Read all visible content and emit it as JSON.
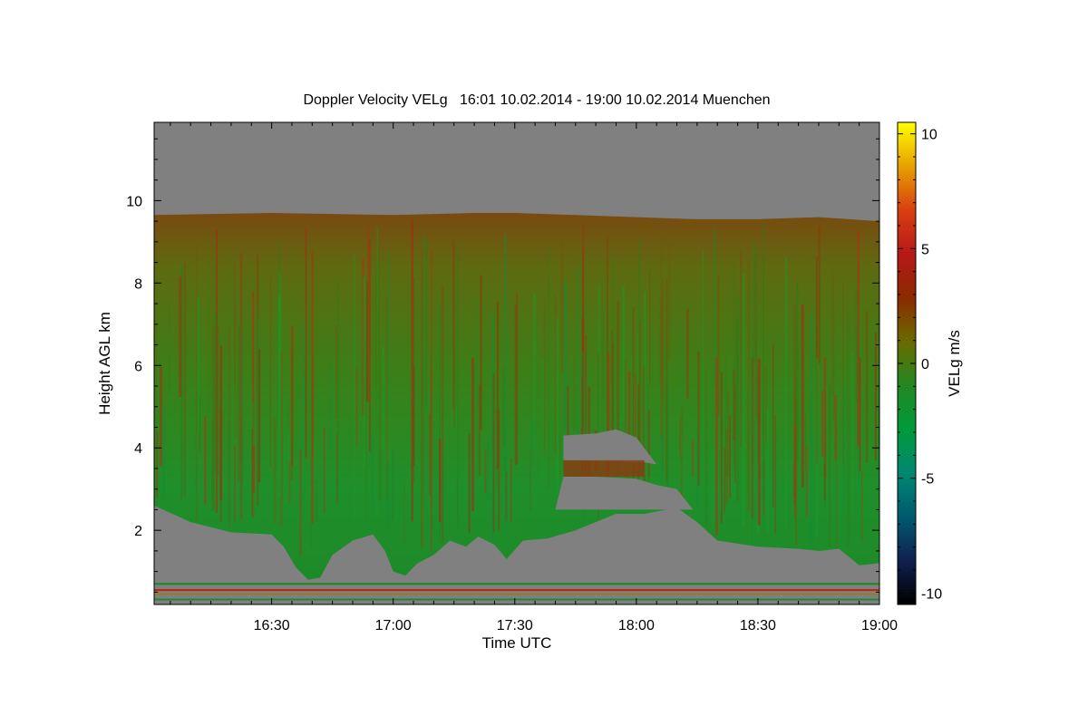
{
  "chart_data": {
    "type": "heatmap",
    "title": "Doppler Velocity VELg   16:01 10.02.2014 - 19:00 10.02.2014 Muenchen",
    "xlabel": "Time UTC",
    "ylabel": "Height AGL km",
    "x_range": [
      "16:01",
      "19:00"
    ],
    "x_ticks": [
      "16:30",
      "17:00",
      "17:30",
      "18:00",
      "18:30",
      "19:00"
    ],
    "ylim": [
      0.2,
      11.9
    ],
    "y_ticks": [
      2,
      4,
      6,
      8,
      10
    ],
    "colorbar": {
      "label": "VELg m/s",
      "range": [
        -10.5,
        10.5
      ],
      "ticks": [
        10,
        5,
        0,
        -5,
        -10
      ],
      "colors": [
        "#ffff00",
        "#e8a000",
        "#d84010",
        "#b81818",
        "#8a2a00",
        "#6a6a00",
        "#228822",
        "#009a3a",
        "#008870",
        "#005a70",
        "#102050",
        "#000000"
      ]
    },
    "no_data_color": "#808080",
    "echo_top_km": [
      [
        "16:01",
        9.65
      ],
      [
        "16:30",
        9.7
      ],
      [
        "17:00",
        9.65
      ],
      [
        "17:20",
        9.7
      ],
      [
        "17:30",
        9.7
      ],
      [
        "17:45",
        9.65
      ],
      [
        "18:00",
        9.6
      ],
      [
        "18:15",
        9.55
      ],
      [
        "18:30",
        9.55
      ],
      [
        "18:45",
        9.6
      ],
      [
        "19:00",
        9.5
      ]
    ],
    "cloud_base_km": [
      [
        "16:01",
        2.6
      ],
      [
        "16:10",
        2.2
      ],
      [
        "16:20",
        1.95
      ],
      [
        "16:30",
        1.9
      ],
      [
        "16:33",
        1.6
      ],
      [
        "16:36",
        1.1
      ],
      [
        "16:39",
        0.8
      ],
      [
        "16:42",
        0.85
      ],
      [
        "16:45",
        1.4
      ],
      [
        "16:50",
        1.75
      ],
      [
        "16:55",
        1.9
      ],
      [
        "16:58",
        1.5
      ],
      [
        "17:00",
        1.0
      ],
      [
        "17:03",
        0.9
      ],
      [
        "17:06",
        1.2
      ],
      [
        "17:10",
        1.4
      ],
      [
        "17:14",
        1.75
      ],
      [
        "17:18",
        1.6
      ],
      [
        "17:21",
        1.85
      ],
      [
        "17:25",
        1.65
      ],
      [
        "17:28",
        1.3
      ],
      [
        "17:32",
        1.75
      ],
      [
        "17:38",
        1.8
      ],
      [
        "17:45",
        2.0
      ],
      [
        "17:55",
        2.4
      ],
      [
        "18:02",
        2.4
      ],
      [
        "18:10",
        2.55
      ],
      [
        "18:15",
        2.2
      ],
      [
        "18:20",
        1.75
      ],
      [
        "18:30",
        1.6
      ],
      [
        "18:40",
        1.55
      ],
      [
        "18:45",
        1.5
      ],
      [
        "18:50",
        1.55
      ],
      [
        "18:55",
        1.15
      ],
      [
        "19:00",
        1.2
      ]
    ],
    "clear_gaps": [
      {
        "top_km": [
          [
            "17:42",
            4.3
          ],
          [
            "17:50",
            4.35
          ],
          [
            "17:55",
            4.45
          ],
          [
            "18:00",
            4.25
          ],
          [
            "18:05",
            3.6
          ]
        ],
        "bottom_km": 3.3
      },
      {
        "top_km": [
          [
            "17:42",
            3.3
          ],
          [
            "17:50",
            3.3
          ],
          [
            "18:00",
            3.25
          ],
          [
            "18:05",
            3.1
          ],
          [
            "18:10",
            3.0
          ]
        ],
        "bottom_km": 2.5
      }
    ],
    "velocity_field": [
      {
        "height_km": 9.0,
        "VELg": 1.5
      },
      {
        "height_km": 7.0,
        "VELg": 0.0
      },
      {
        "height_km": 5.0,
        "VELg": -1.0
      },
      {
        "height_km": 3.0,
        "VELg": -1.5
      }
    ],
    "near_ground_lines_km": [
      0.7,
      0.55,
      0.45,
      0.32
    ]
  }
}
